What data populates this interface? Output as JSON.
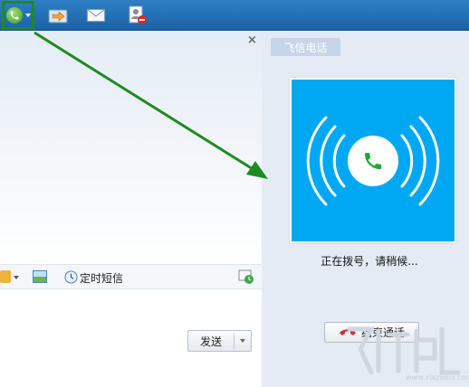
{
  "toolbar": {
    "icons": [
      "phone-icon",
      "share-icon",
      "mail-icon",
      "contact-block-icon"
    ]
  },
  "chat": {
    "close_symbol": "×",
    "input_toolbar": {
      "scheduled_sms_label": "定时短信"
    },
    "send_label": "发送"
  },
  "call_panel": {
    "tab_label": "飞信电话",
    "status_text": "正在拨号，请稍候...",
    "end_call_label": "结束通话"
  },
  "colors": {
    "call_card_bg": "#00a8f3",
    "arrow": "#1f8a1f",
    "toolbar_bg": "#1c62a8"
  },
  "watermark": {
    "text": "www.xiazaiba.com"
  }
}
